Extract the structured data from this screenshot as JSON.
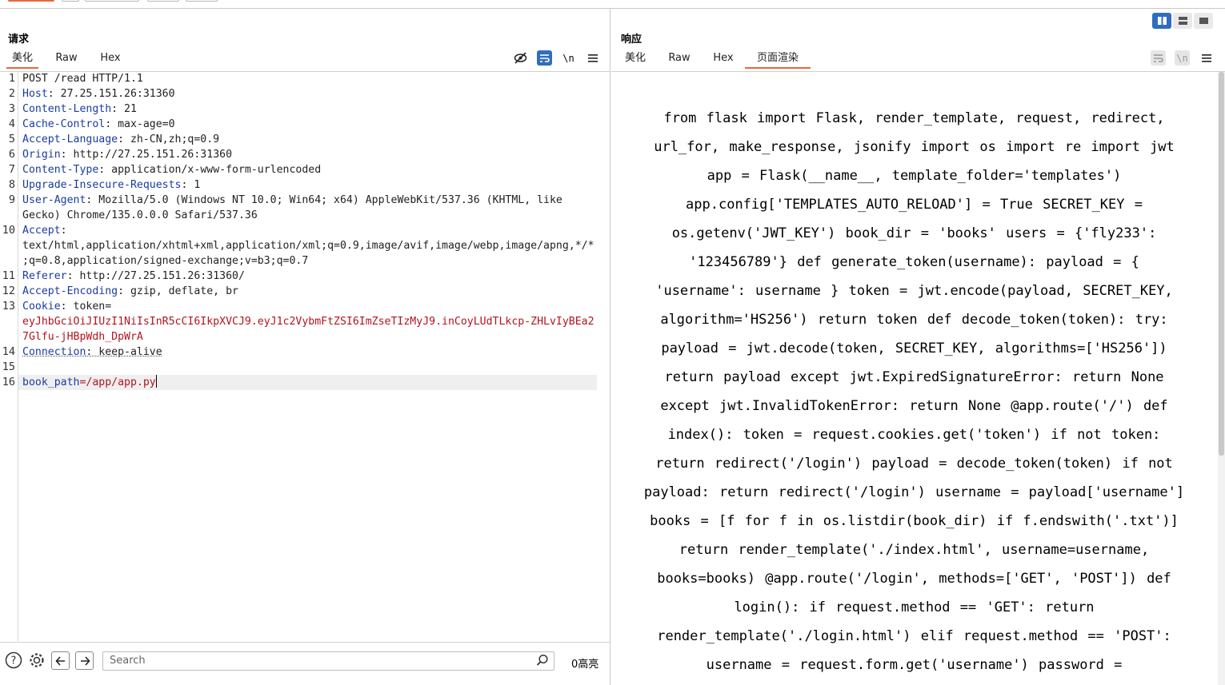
{
  "request": {
    "title": "请求",
    "tabs": [
      "美化",
      "Raw",
      "Hex"
    ],
    "active_tab": "美化",
    "lines": [
      {
        "n": "1",
        "key": "POST /read HTTP/1.1",
        "val": ""
      },
      {
        "n": "2",
        "key": "Host",
        "val": ": 27.25.151.26:31360"
      },
      {
        "n": "3",
        "key": "Content-Length",
        "val": ": 21"
      },
      {
        "n": "4",
        "key": "Cache-Control",
        "val": ": max-age=0"
      },
      {
        "n": "5",
        "key": "Accept-Language",
        "val": ": zh-CN,zh;q=0.9"
      },
      {
        "n": "6",
        "key": "Origin",
        "val": ": http://27.25.151.26:31360"
      },
      {
        "n": "7",
        "key": "Content-Type",
        "val": ": application/x-www-form-urlencoded"
      },
      {
        "n": "8",
        "key": "Upgrade-Insecure-Requests",
        "val": ": 1"
      },
      {
        "n": "9",
        "key": "User-Agent",
        "val": ": Mozilla/5.0 (Windows NT 10.0; Win64; x64) AppleWebKit/537.36 (KHTML, like",
        "cont": "Gecko) Chrome/135.0.0.0 Safari/537.36"
      },
      {
        "n": "10",
        "key": "Accept",
        "val": ":",
        "cont": "text/html,application/xhtml+xml,application/xml;q=0.9,image/avif,image/webp,image/apng,*/*",
        "cont2": ";q=0.8,application/signed-exchange;v=b3;q=0.7"
      },
      {
        "n": "11",
        "key": "Referer",
        "val": ": http://27.25.151.26:31360/"
      },
      {
        "n": "12",
        "key": "Accept-Encoding",
        "val": ": gzip, deflate, br"
      },
      {
        "n": "13",
        "key": "Cookie",
        "val": ": token=",
        "cont": "eyJhbGciOiJIUzI1NiIsInR5cCI6IkpXVCJ9.eyJ1c2VybmFtZSI6ImZseTIzMyJ9.inCoyLUdTLkcp-ZHLvIyBEa2",
        "cont2": "7Glfu-jHBpWdh_DpWrA"
      },
      {
        "n": "14",
        "key": "Connection",
        "val": ": keep-alive"
      },
      {
        "n": "15",
        "key": "",
        "val": ""
      },
      {
        "n": "16",
        "key": "book_path",
        "val": "=/app/app.py"
      }
    ]
  },
  "response": {
    "title": "响应",
    "tabs": [
      "美化",
      "Raw",
      "Hex",
      "页面渲染"
    ],
    "active_tab": "页面渲染",
    "rendered_text": "from flask import Flask, render_template, request, redirect, url_for, make_response, jsonify import os import re import jwt app = Flask(__name__, template_folder='templates') app.config['TEMPLATES_AUTO_RELOAD'] = True SECRET_KEY = os.getenv('JWT_KEY') book_dir = 'books' users = {'fly233': '123456789'} def generate_token(username): payload = { 'username': username } token = jwt.encode(payload, SECRET_KEY, algorithm='HS256') return token def decode_token(token): try: payload = jwt.decode(token, SECRET_KEY, algorithms=['HS256']) return payload except jwt.ExpiredSignatureError: return None except jwt.InvalidTokenError: return None @app.route('/') def index(): token = request.cookies.get('token') if not token: return redirect('/login') payload = decode_token(token) if not payload: return redirect('/login') username = payload['username'] books = [f for f in os.listdir(book_dir) if f.endswith('.txt')] return render_template('./index.html', username=username, books=books) @app.route('/login', methods=['GET', 'POST']) def login(): if request.method == 'GET': return render_template('./login.html') elif request.method == 'POST': username = request.form.get('username') password ="
  },
  "bottom": {
    "search_placeholder": "Search",
    "highlight_count": "0高亮"
  },
  "icons": {
    "hide": "eye-off-icon",
    "wrap": "wrap-icon",
    "newline": "\\n",
    "menu": "menu-icon"
  },
  "colors": {
    "accent": "#e8673c",
    "blue": "#2f6dbf",
    "key": "#1a3ca3",
    "cookie": "#b3141d"
  }
}
